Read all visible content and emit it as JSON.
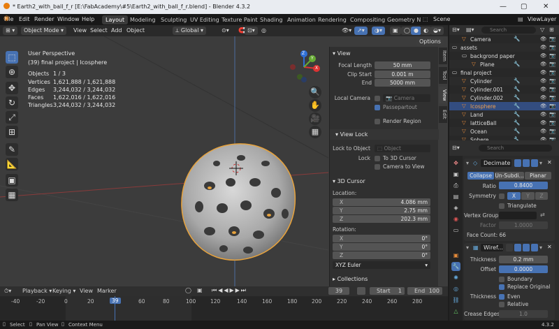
{
  "window": {
    "title": "* Earth2_with_ball_f_r [E:\\FabAcademy\\#5\\Earth2_with_ball_f_r.blend] - Blender 4.3.2"
  },
  "menu": {
    "file": "File",
    "edit": "Edit",
    "render": "Render",
    "window": "Window",
    "help": "Help"
  },
  "workspaces": [
    "Layout",
    "Modeling",
    "Sculpting",
    "UV Editing",
    "Texture Paint",
    "Shading",
    "Animation",
    "Rendering",
    "Compositing",
    "Geometry N"
  ],
  "scene": {
    "label": "Scene",
    "view_layer": "ViewLayer"
  },
  "viewport_header": {
    "mode": "Object Mode",
    "view": "View",
    "select": "Select",
    "add": "Add",
    "object": "Object",
    "orientation": "Global",
    "options": "Options"
  },
  "overlay_info": {
    "perspective": "User Perspective",
    "collection": "(39) final project | Icosphere",
    "rows": [
      {
        "label": "Objects",
        "value": "1 / 3"
      },
      {
        "label": "Vertices",
        "value": "1,621,888 / 1,621,888"
      },
      {
        "label": "Edges",
        "value": "3,244,032 / 3,244,032"
      },
      {
        "label": "Faces",
        "value": "1,622,016 / 1,622,016"
      },
      {
        "label": "Triangles",
        "value": "3,244,032 / 3,244,032"
      }
    ]
  },
  "gizmo": {
    "x": "X",
    "y": "Y",
    "z": "Z"
  },
  "npanel": {
    "tabs": [
      "Item",
      "Tool",
      "View",
      "Edit"
    ],
    "view_header": "View",
    "focal_length_label": "Focal Length",
    "focal_length": "50 mm",
    "clip_start_label": "Clip Start",
    "clip_start": "0.001 m",
    "end_label": "End",
    "clip_end": "5000 mm",
    "local_camera_label": "Local Camera",
    "camera_placeholder": "Camera",
    "passepartout": "Passepartout",
    "render_region": "Render Region",
    "view_lock_header": "View Lock",
    "lock_to_object_label": "Lock to Object",
    "object_placeholder": "Object",
    "lock_label": "Lock",
    "to_3d_cursor": "To 3D Cursor",
    "camera_to_view": "Camera to View",
    "cursor_header": "3D Cursor",
    "location_label": "Location:",
    "loc_x": "4.086 mm",
    "loc_y": "2.75 mm",
    "loc_z": "202.3 mm",
    "rotation_label": "Rotation:",
    "rot_x": "0°",
    "rot_y": "0°",
    "rot_z": "0°",
    "rotation_mode": "XYZ Euler",
    "collections_header": "Collections"
  },
  "outliner": {
    "search_placeholder": "Search",
    "rows": [
      {
        "name": "Camera",
        "indent": 28
      },
      {
        "name": "assets",
        "indent": 14
      },
      {
        "name": "backgrond paper",
        "indent": 28
      },
      {
        "name": "Plane",
        "indent": 42
      },
      {
        "name": "final project",
        "indent": 14
      },
      {
        "name": "Cylinder",
        "indent": 28
      },
      {
        "name": "Cylinder.001",
        "indent": 28
      },
      {
        "name": "Cylinder.002",
        "indent": 28
      },
      {
        "name": "Icosphere",
        "indent": 28
      },
      {
        "name": "Land",
        "indent": 28
      },
      {
        "name": "latticeBall",
        "indent": 28
      },
      {
        "name": "Ocean",
        "indent": 28
      },
      {
        "name": "Sphere",
        "indent": 28
      }
    ]
  },
  "properties": {
    "search_placeholder": "Search",
    "decimate": {
      "name": "Decimate",
      "modes": [
        "Collapse",
        "Un-Subdi...",
        "Planar"
      ],
      "ratio_label": "Ratio",
      "ratio": "0.8400",
      "symmetry_label": "Symmetry",
      "axes": [
        "X",
        "Y",
        "Z"
      ],
      "triangulate": "Triangulate",
      "vertex_group_label": "Vertex Group",
      "factor_label": "Factor",
      "factor": "1.0000",
      "face_count": "Face Count: 66"
    },
    "wireframe": {
      "name": "Wiref...",
      "thickness_label": "Thickness",
      "thickness": "0.2 mm",
      "offset_label": "Offset",
      "offset": "0.0000",
      "boundary": "Boundary",
      "replace_original": "Replace Original",
      "thickness2_label": "Thickness",
      "even": "Even",
      "relative": "Relative",
      "crease_label": "Crease Edges",
      "crease": "1.0"
    }
  },
  "timeline": {
    "playback": "Playback",
    "keying": "Keying",
    "view": "View",
    "marker": "Marker",
    "current_frame": "39",
    "start_label": "Start",
    "start": "1",
    "end_label": "End",
    "end": "100",
    "ruler": [
      "-40",
      "-20",
      "0",
      "20",
      "39",
      "60",
      "80",
      "100",
      "120",
      "140",
      "160",
      "180",
      "200",
      "220",
      "240",
      "260",
      "280"
    ]
  },
  "statusbar": {
    "select": "Select",
    "pan": "Pan View",
    "context": "Context Menu",
    "version": "4.3.2"
  },
  "colors": {
    "accent": "#4772b3",
    "selection": "#e8a33c",
    "frame": "#4772b3"
  }
}
